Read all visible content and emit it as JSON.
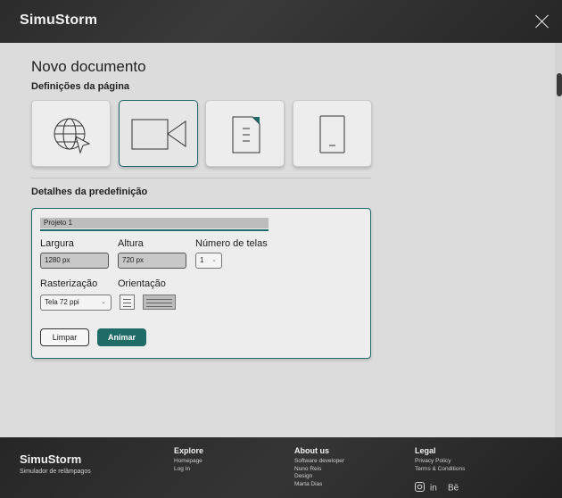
{
  "header": {
    "brand": "SimuStorm"
  },
  "page": {
    "title": "Novo documento",
    "section_page_settings": "Definições da página",
    "section_preset_details": "Detalhes da predefinição"
  },
  "presets": [
    {
      "icon": "globe-cursor-icon",
      "selected": false
    },
    {
      "icon": "video-camera-icon",
      "selected": true
    },
    {
      "icon": "document-icon",
      "selected": false
    },
    {
      "icon": "phone-icon",
      "selected": false
    }
  ],
  "details": {
    "project_name": "Projeto 1",
    "width_label": "Largura",
    "width_value": "1280 px",
    "height_label": "Altura",
    "height_value": "720 px",
    "screens_label": "Número de telas",
    "screens_value": "1",
    "raster_label": "Rasterização",
    "raster_value": "Tela 72 ppi",
    "orientation_label": "Orientação",
    "orientation_selected": "landscape",
    "clear_label": "Limpar",
    "animate_label": "Animar"
  },
  "footer": {
    "brand": "SimuStorm",
    "tagline": "Simulador de relâmpagos",
    "explore": {
      "title": "Explore",
      "links": [
        "Homepage",
        "Log In"
      ]
    },
    "about": {
      "title": "About us",
      "links": [
        "Software developer",
        "Nuno Reis",
        "Design",
        "Marta Dias"
      ]
    },
    "legal": {
      "title": "Legal",
      "links": [
        "Privacy Policy",
        "Terms & Conditions"
      ]
    },
    "social_icons": [
      "instagram-icon",
      "linkedin-icon",
      "behance-icon"
    ]
  },
  "colors": {
    "accent": "#1e6b68",
    "header_bg": "#2b2b2b",
    "page_bg": "#dcdcdc"
  }
}
